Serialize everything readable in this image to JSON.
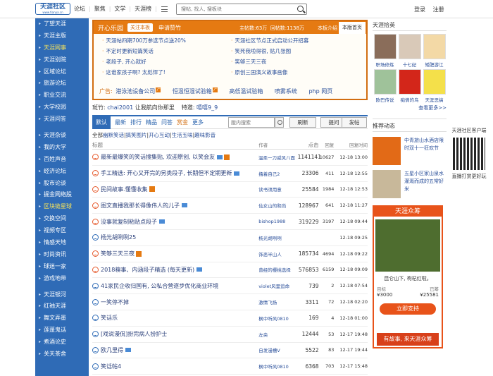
{
  "logo": {
    "text": "天涯社区",
    "sub": "www.tianya.cn"
  },
  "topnav": {
    "items": [
      "论坛",
      "聚焦",
      "文学",
      "天涯榜"
    ]
  },
  "search": {
    "placeholder": "搜帖, 找人, 搜板块"
  },
  "login": {
    "login": "登录",
    "register": "注册"
  },
  "sidebar": {
    "group1": [
      {
        "label": "了望天涯",
        "hl": false
      },
      {
        "label": "天涯主版",
        "hl": false
      },
      {
        "label": "天涯网事",
        "hl": true
      },
      {
        "label": "天涯别院",
        "hl": false
      },
      {
        "label": "区域论坛",
        "hl": false
      },
      {
        "label": "旅游论坛",
        "hl": false
      },
      {
        "label": "职业交流",
        "hl": false
      },
      {
        "label": "大学校园",
        "hl": false
      },
      {
        "label": "天涯问答",
        "hl": false
      }
    ],
    "group2": [
      {
        "label": "天涯杂谈",
        "hl": false
      },
      {
        "label": "我的大学",
        "hl": false
      },
      {
        "label": "百姓声音",
        "hl": false
      },
      {
        "label": "经济论坛",
        "hl": false
      },
      {
        "label": "股市论谈",
        "hl": false
      },
      {
        "label": "掘金网络股",
        "hl": false
      },
      {
        "label": "区块链星球",
        "hl": true
      },
      {
        "label": "交换空间",
        "hl": false
      },
      {
        "label": "视频专区",
        "hl": false
      },
      {
        "label": "情感天地",
        "hl": false
      },
      {
        "label": "时尚资讯",
        "hl": false
      },
      {
        "label": "球迷一家",
        "hl": false
      },
      {
        "label": "游戏地带",
        "hl": false
      }
    ],
    "group3": [
      {
        "label": "天涯银河",
        "hl": false
      },
      {
        "label": "红袖天涯",
        "hl": false
      },
      {
        "label": "舞文弄墨",
        "hl": false
      },
      {
        "label": "莲蓬鬼话",
        "hl": false
      },
      {
        "label": "煮酒论史",
        "hl": false
      },
      {
        "label": "关天茶舍",
        "hl": false
      }
    ]
  },
  "banner": {
    "title": "开心乐园",
    "follow": "关注本板",
    "menu_label": "申请赞竹",
    "stat_label1": "主帖数:",
    "stat_value1": "63万",
    "stat_label2": "回帖数:",
    "stat_value2": "1138万",
    "tab_intro": "本板介绍",
    "tab_home": "本版首页",
    "links": [
      "天涯帖四期700万参选节点送20%",
      "天涯社区节点正式启动公开招募",
      "不定时更新短篇笑话",
      "笑死我啦得很, 贴几张图",
      "老段子, 开心就好",
      "笑够三天三夜",
      "这谁家孩子啊? 太彪悍了!",
      "原创三国演义故事画像"
    ],
    "ad_tag": "广告:",
    "ads": [
      "港泳池设备公司",
      "恒温恒湿试验箱",
      "高低温试验箱",
      "喷雾系统",
      "php 网页"
    ]
  },
  "notice": {
    "label": "斑竹:",
    "user": "chai2001",
    "slogan": "让我航向你那里",
    "special_label": "特邀:",
    "special_user": "嘻嘻9_9"
  },
  "tabs": {
    "items": [
      "默认",
      "最新",
      "排行",
      "精品",
      "问答",
      "赏金",
      "更多"
    ],
    "search_placeholder": "版内搜索",
    "refresh": "刷新",
    "ask": "提问",
    "post": "发帖"
  },
  "cats": {
    "label": "全部",
    "items": [
      "幽默笑话",
      "搞笑图片",
      "开心互动",
      "生活五味",
      "趣味影音"
    ]
  },
  "table_head": {
    "title": "标题",
    "author": "作者",
    "clicks": "点击",
    "replies": "回复",
    "time": "回复时间"
  },
  "rows": [
    {
      "title": "最新最爆笑的笑话搜集贴, 欢迎原创, 以笑会友",
      "author": "温柔一刀威风八面",
      "clicks": "1141141",
      "replies": "10627",
      "time": "12-18 13:00",
      "pic": true,
      "hot": true,
      "face": "red"
    },
    {
      "title": "手工精选: 开心又开完的另类段子, 长期但不定期更新",
      "author": "撸着自己2",
      "clicks": "23306",
      "replies": "411",
      "time": "12-18 12:55",
      "pic": true,
      "hot": false,
      "face": "red"
    },
    {
      "title": "民间故事.懂懂收集",
      "author": "读书须用意",
      "clicks": "25584",
      "replies": "1984",
      "time": "12-18 12:53",
      "pic": false,
      "hot": true,
      "face": "red"
    },
    {
      "title": "图文直播我那长得像伟人的儿子",
      "author": "仙女山的和尚",
      "clicks": "128967",
      "replies": "641",
      "time": "12-18 11:27",
      "pic": true,
      "hot": false,
      "face": "red"
    },
    {
      "title": "没事就复制粘贴点段子",
      "author": "bishop1988",
      "clicks": "319229",
      "replies": "3197",
      "time": "12-18 09:44",
      "pic": true,
      "hot": false,
      "face": "red"
    },
    {
      "title": "杨光胡咧咧25",
      "author": "杨光胡咧咧",
      "clicks": "",
      "replies": "",
      "time": "12-18 09:25",
      "pic": false,
      "hot": false,
      "face": "blue"
    },
    {
      "title": "笑够三天三夜",
      "author": "饰恶半山人",
      "clicks": "185734",
      "replies": "4694",
      "time": "12-18 09:22",
      "pic": false,
      "hot": true,
      "face": "red"
    },
    {
      "title": "2018糗事、内涵段子精选 (每天更新)",
      "author": "曾经的樱桃选择",
      "clicks": "576853",
      "replies": "6159",
      "time": "12-18 09:09",
      "pic": true,
      "hot": false,
      "face": "red"
    },
    {
      "title": "41家民企收归国有, 公私合营逐步优化商业环境",
      "author": "violet风里追命",
      "clicks": "739",
      "replies": "2",
      "time": "12-18 07:54",
      "pic": false,
      "hot": false,
      "face": "blue"
    },
    {
      "title": "一笑停不掉",
      "author": "激情飞扬",
      "clicks": "3311",
      "replies": "72",
      "time": "12-18 02:20",
      "pic": false,
      "hot": false,
      "face": "blue"
    },
    {
      "title": "笑话乐",
      "author": "枫中听风0810",
      "clicks": "169",
      "replies": "4",
      "time": "12-18 01:00",
      "pic": false,
      "hot": false,
      "face": "blue"
    },
    {
      "title": "[戏说漫侃]扮完病人扮护士",
      "author": "左央",
      "clicks": "12444",
      "replies": "53",
      "time": "12-17 19:48",
      "pic": false,
      "hot": false,
      "face": "blue"
    },
    {
      "title": "欧几里得",
      "author": "自发漫槽V",
      "clicks": "5522",
      "replies": "83",
      "time": "12-17 19:44",
      "pic": true,
      "hot": false,
      "face": "blue"
    },
    {
      "title": "笑话帖4",
      "author": "枫中听风0810",
      "clicks": "6368",
      "replies": "703",
      "time": "12-17 15:48",
      "pic": false,
      "hot": false,
      "face": "blue"
    }
  ],
  "right": {
    "recommend_title": "天涯拾英",
    "tiles": [
      "职场修炼",
      "十七纪",
      "矮肥游江",
      "欧巴传说",
      "痴情的鸟",
      "天涯恶搞"
    ],
    "more": "查看更多>>",
    "dynamic_title": "推荐动态",
    "recs": [
      {
        "text": "中青旅山水酒店限时双十一狂欢节"
      },
      {
        "text": "五星小区家山泉水灌溉而成的五常好米"
      }
    ],
    "promo_head": "天涯众筹",
    "promo_title": "昆仑山下, 枸杞红啦。",
    "goal_label": "目标",
    "goal_value": "¥3000",
    "raised_label": "已筹",
    "raised_value": "¥25581",
    "promo_btn": "立即支持",
    "promo_foot": "有故事, 来天涯众筹"
  },
  "app": {
    "title": "天涯社区客户端",
    "sub": "直播打赏更好玩"
  }
}
